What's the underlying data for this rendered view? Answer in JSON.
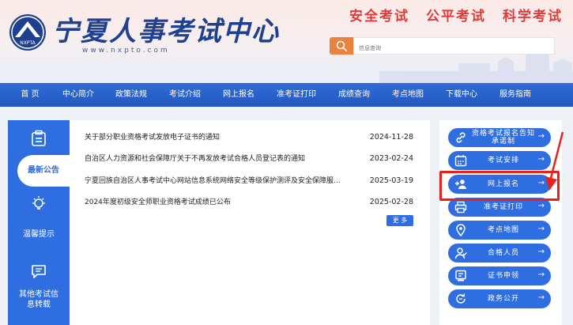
{
  "header": {
    "logo_text": "宁夏人事考试中心",
    "logo_url": "www.nxpto.com",
    "emblem_text": "NXPTA",
    "slogans": [
      "安全考试",
      "公平考试",
      "科学考试"
    ],
    "search_placeholder": "信息查询"
  },
  "nav": [
    "首 页",
    "中心简介",
    "政策法规",
    "考试介绍",
    "网上报名",
    "准考证打印",
    "成绩查询",
    "考点地图",
    "下载中心",
    "服务指南"
  ],
  "tabs": [
    {
      "label": "最新公告",
      "icon": "clipboard-icon",
      "active": true
    },
    {
      "label": "温馨提示",
      "icon": "lightbulb-icon",
      "active": false
    },
    {
      "label": "其他考试信息转载",
      "icon": "chat-icon",
      "active": false
    }
  ],
  "news": [
    {
      "title": "关于部分职业资格考试发放电子证书的通知",
      "date": "2024-11-28"
    },
    {
      "title": "自治区人力资源和社会保障厅关于不再发放考试合格人员登记表的通知",
      "date": "2023-02-24"
    },
    {
      "title": "宁夏回族自治区人事考试中心网站信息系统网络安全等级保护测评及安全保障服...",
      "date": "2025-03-19"
    },
    {
      "title": "2024年度初级安全师职业资格考试成绩已公布",
      "date": "2025-02-28"
    }
  ],
  "more_label": "更 多",
  "quick_links": [
    {
      "label": "资格考试报名告知承诺制",
      "icon": "link-icon"
    },
    {
      "label": "考试安排",
      "icon": "calendar-icon"
    },
    {
      "label": "网上报名",
      "icon": "add-user-icon"
    },
    {
      "label": "准考证打印",
      "icon": "printer-icon"
    },
    {
      "label": "考点地图",
      "icon": "map-pin-icon"
    },
    {
      "label": "合格人员",
      "icon": "person-icon"
    },
    {
      "label": "证书申领",
      "icon": "certificate-icon"
    },
    {
      "label": "政务公开",
      "icon": "refresh-icon"
    }
  ],
  "arrow_glyph": "→",
  "colors": {
    "primary": "#2f6ee0",
    "slogan": "#e23a3a",
    "search": "#e9823f",
    "highlight": "#e8211a"
  }
}
